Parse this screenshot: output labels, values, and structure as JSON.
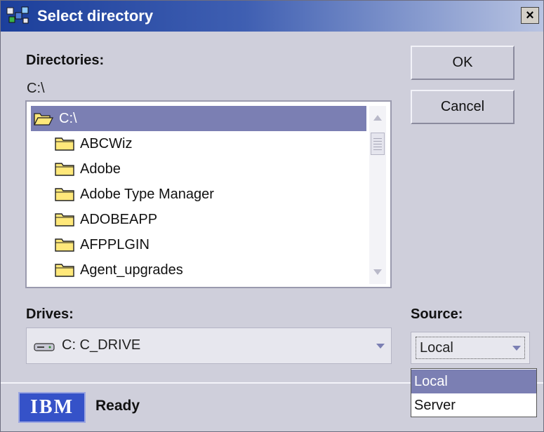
{
  "window": {
    "title": "Select directory",
    "close_label": "×"
  },
  "directories": {
    "label": "Directories:",
    "current_path": "C:\\",
    "items": [
      {
        "name": "C:\\",
        "selected": true,
        "open": true
      },
      {
        "name": "ABCWiz"
      },
      {
        "name": "Adobe"
      },
      {
        "name": "Adobe Type Manager"
      },
      {
        "name": "ADOBEAPP"
      },
      {
        "name": "AFPPLGIN"
      },
      {
        "name": "Agent_upgrades"
      }
    ]
  },
  "buttons": {
    "ok_label": "OK",
    "cancel_label": "Cancel"
  },
  "drives": {
    "label": "Drives:",
    "value": "C:  C_DRIVE"
  },
  "source": {
    "label": "Source:",
    "value": "Local",
    "options": [
      {
        "label": "Local",
        "selected": true
      },
      {
        "label": "Server"
      }
    ]
  },
  "status": {
    "logo": "IBM",
    "text": "Ready"
  },
  "colors": {
    "selection": "#7b7fb3",
    "titlebar_start": "#1c3f9b",
    "window_bg": "#cfcfdb",
    "folder_fill": "#ffe87a"
  }
}
